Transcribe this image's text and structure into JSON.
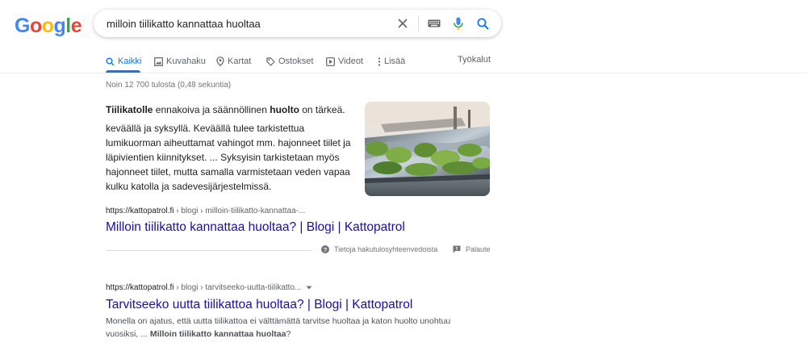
{
  "logo": {
    "letters": [
      "G",
      "o",
      "o",
      "g",
      "l",
      "e"
    ],
    "colors": [
      "#4285f4",
      "#ea4335",
      "#fbbc05",
      "#4285f4",
      "#34a853",
      "#ea4335"
    ]
  },
  "search": {
    "query": "milloin tiilikatto kannattaa huoltaa"
  },
  "icons": {
    "clear": "close-icon",
    "keyboard": "keyboard-icon",
    "voice": "mic-icon",
    "search": "search-icon"
  },
  "tabs": [
    {
      "label": "Kaikki",
      "icon": "search-icon",
      "active": true
    },
    {
      "label": "Kuvahaku",
      "icon": "image-icon"
    },
    {
      "label": "Kartat",
      "icon": "map-pin-icon"
    },
    {
      "label": "Ostokset",
      "icon": "tag-icon"
    },
    {
      "label": "Videot",
      "icon": "video-icon"
    },
    {
      "label": "Lisää",
      "icon": "more-vert-icon"
    }
  ],
  "tools_label": "Työkalut",
  "stats": "Noin 12 700 tulosta (0,48 sekuntia)",
  "featured": {
    "title_pre": "Tiilikatolle",
    "title_mid": " ennakoiva ja säännöllinen ",
    "title_bold": "huolto",
    "title_post": " on tärkeä.",
    "text": "keväällä ja syksyllä. Keväällä tulee tarkistettua lumikuorman aiheuttamat vahingot mm. hajonneet tiilet ja läpivientien kiinnitykset. ... Syksyisin tarkistetaan myös hajonneet tiilet, mutta samalla varmistetaan veden vapaa kulku katolla ja sadevesijärjestelmissä.",
    "cite_domain": "https://kattopatrol.fi",
    "cite_path": " › blogi › milloin-tiilikatto-kannattaa-...",
    "link": "Milloin tiilikatto kannattaa huoltaa? | Blogi | Kattopatrol",
    "about": "Tietoja hakutulosyhteenvedoista",
    "feedback": "Palaute"
  },
  "result2": {
    "cite_domain": "https://kattopatrol.fi",
    "cite_path": " › blogi › tarvitseeko-uutta-tiilikatto...",
    "link": "Tarvitseeko uutta tiilikattoa huoltaa? | Blogi | Kattopatrol",
    "snippet_pre": "Monella on ajatus, että uutta tiilikattoa ei välttämättä tarvitse huoltaa ja katon huolto unohtuu vuosiksi, ... ",
    "snippet_bold": "Milloin tiilikatto kannattaa huoltaa",
    "snippet_post": "?"
  },
  "colors": {
    "link": "#1a0dab",
    "accent": "#1a73e8",
    "muted": "#70757a"
  }
}
